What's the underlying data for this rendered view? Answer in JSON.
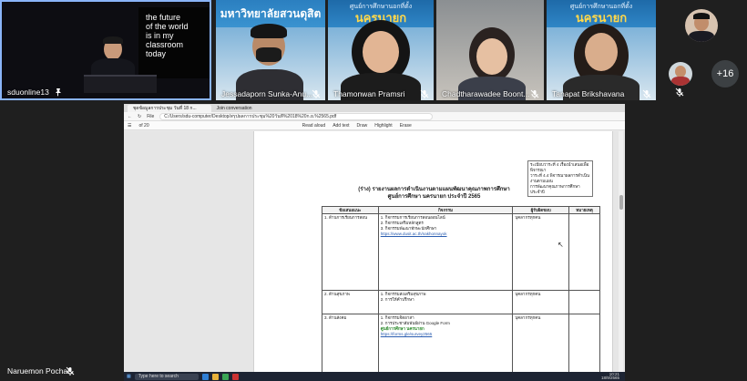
{
  "participants": [
    {
      "name": "sduonline13",
      "icon": "pin-icon"
    },
    {
      "name": "Jessadaporn Sunka-Anu...",
      "icon": "mic-off-icon"
    },
    {
      "name": "Thamonwan Pramsri",
      "icon": "mic-off-icon"
    },
    {
      "name": "Chadtharawadee Boont...",
      "icon": "mic-off-icon"
    },
    {
      "name": "Tanapat Brikshavana",
      "icon": "mic-off-icon"
    }
  ],
  "board_text": [
    "the future",
    "of the world",
    "is in my",
    "classroom",
    "today"
  ],
  "banners": {
    "university": "มหาวิทยาลัยสวนดุสิต",
    "center_sub": "ศูนย์การศึกษานอกที่ตั้ง",
    "center_main": "นครนายก"
  },
  "more_participants": "+16",
  "self_name": "Naruemon Pochai",
  "colors": {
    "highlight": "#8ab4f8",
    "banner": "#2f86c6",
    "banner_text": "#ffd84a"
  },
  "browser": {
    "tab_title": "ชุดข้อมูลการประชุม วันที่ 18 ก...",
    "tab2": "Join conversation",
    "url": "C:/Users/sdu-computer/Desktop/สรุปผลการประชุม%20วันที่%2018%20ก.ย.%2565.pdf",
    "file_label": "File",
    "page_info": "of 20",
    "tools": [
      "Read aloud",
      "Add text",
      "Draw",
      "Highlight",
      "Erase"
    ]
  },
  "document": {
    "note_lines": [
      "ระเบียบวาระที่ 4 เรื่องนำเสนอเพื่อพิจารณา",
      "วาระที่ 4.4 พิจารณาผลการดำเนินงานตามแผน",
      "การพัฒนาคุณภาพการศึกษาประจำปี"
    ],
    "title_line1": "(ร่าง) รายงานผลการดำเนินงานตามแผนพัฒนาคุณภาพการศึกษา",
    "title_line2": "ศูนย์การศึกษา นครนายก ประจำปี 2565",
    "table_headers": [
      "ข้อเสนอแนะ",
      "กิจกรรม",
      "ผู้รับผิดชอบ",
      "หมายเหตุ"
    ],
    "rows": [
      {
        "topic": "1. ด้านการเรียนการสอน",
        "items": [
          "1. กิจกรรมการเรียนการสอนออนไลน์",
          "2. กิจกรรมเสริมหลักสูตร",
          "3. กิจกรรมพัฒนาทักษะนักศึกษา"
        ],
        "link": "https://www.dusit.ac.th/nakhonnayok",
        "owner": "บุคลากรทุกคน"
      },
      {
        "topic": "2. ด้านสุขภาพ",
        "items": [
          "1. กิจกรรมส่งเสริมสุขภาพ",
          "2. การให้คำปรึกษา"
        ],
        "link": "",
        "owner": "บุคลากรทุกคน"
      },
      {
        "topic": "3. ด้านสังคม",
        "items": [
          "1. กิจกรรมจิตอาสา",
          "2. การประชาสัมพันธ์ผ่าน Google Form"
        ],
        "highlight": "ศูนย์การศึกษา นครนายก",
        "link": "https://forms.gle/survey2565",
        "owner": "บุคลากรทุกคน"
      }
    ]
  },
  "taskbar": {
    "search": "Type here to search",
    "time": "10:21",
    "date": "18/9/2565"
  }
}
